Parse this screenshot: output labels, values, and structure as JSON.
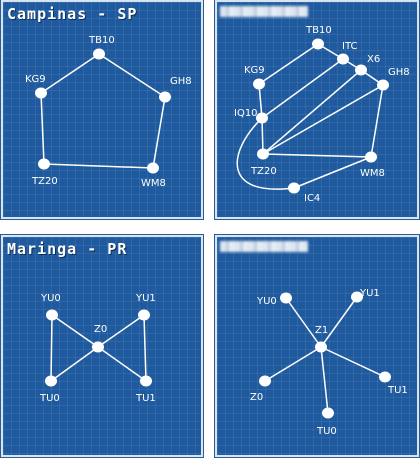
{
  "panels": [
    {
      "title": "Campinas - SP",
      "nodes": [
        "TB10",
        "KG9",
        "GH8",
        "TZ20",
        "WM8"
      ]
    },
    {
      "title": "",
      "nodes": [
        "TB10",
        "ITC",
        "X6",
        "KG9",
        "GH8",
        "IQ10",
        "TZ20",
        "WM8",
        "IC4"
      ]
    },
    {
      "title": "Maringa - PR",
      "nodes": [
        "YU0",
        "YU1",
        "Z0",
        "TU0",
        "TU1"
      ]
    },
    {
      "title": "",
      "nodes": [
        "YU0",
        "YU1",
        "Z1",
        "Z0",
        "TU1",
        "TU0"
      ]
    }
  ]
}
